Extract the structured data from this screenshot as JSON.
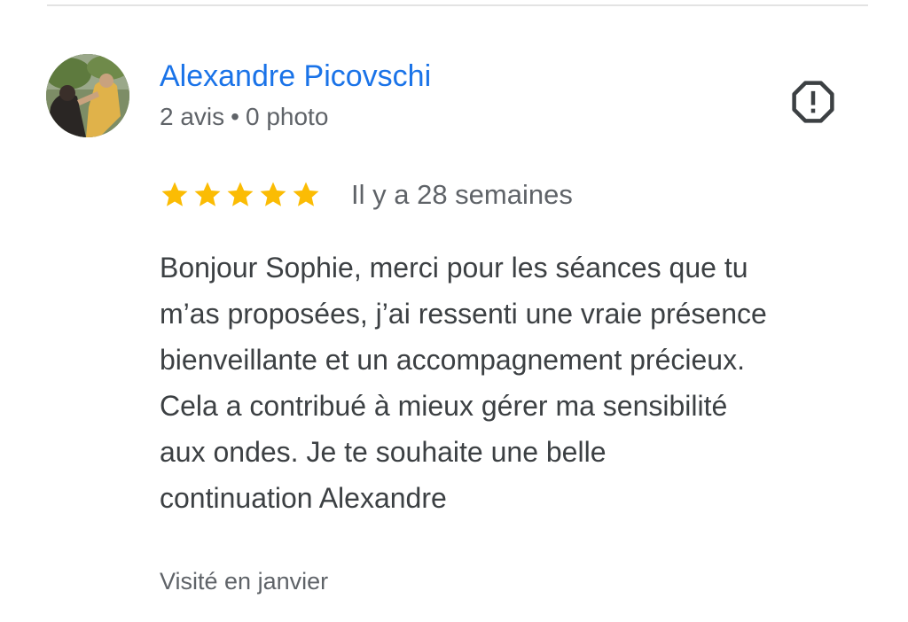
{
  "review": {
    "author": {
      "name": "Alexandre Picovschi",
      "reviews_count": "2 avis",
      "separator": "•",
      "photos_count": "0 photo",
      "avatar_icon": "profile-photo"
    },
    "report_icon": "alert-octagon-icon",
    "rating": 5,
    "rating_max": 5,
    "star_color": "#fbbc04",
    "date": "Il y a 28 semaines",
    "text_lines": [
      "Bonjour Sophie, merci pour les séances que tu",
      "m’as proposées, j’ai ressenti une vraie présence",
      "bienveillante et un accompagnement précieux.",
      "Cela a contribué à mieux gérer ma sensibilité",
      "aux ondes. Je te souhaite une belle",
      "continuation Alexandre"
    ],
    "visit": "Visité en janvier"
  },
  "colors": {
    "link": "#1a73e8",
    "text": "#3c4043",
    "secondary": "#5f6368"
  }
}
